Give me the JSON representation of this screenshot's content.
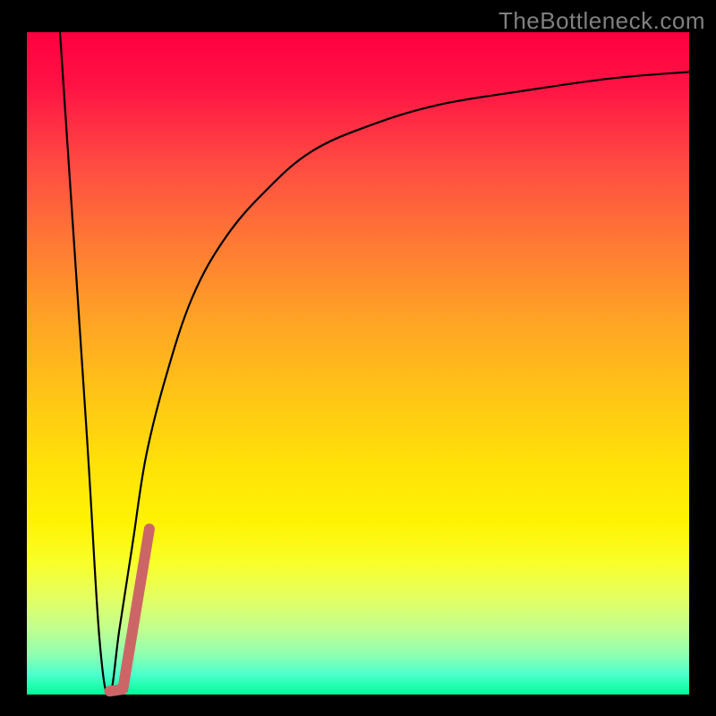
{
  "watermark": "TheBottleneck.com",
  "chart_data": {
    "type": "line",
    "title": "",
    "xlabel": "",
    "ylabel": "",
    "xlim": [
      0,
      100
    ],
    "ylim": [
      0,
      100
    ],
    "series": [
      {
        "name": "black-curve",
        "color": "#000000",
        "width": 2.2,
        "x": [
          5,
          9,
          11,
          12.5,
          14,
          16,
          18,
          21,
          25,
          30,
          36,
          43,
          52,
          62,
          74,
          88,
          100
        ],
        "values": [
          100,
          40,
          8,
          0,
          10,
          23,
          36,
          48,
          60,
          69,
          76,
          82,
          86,
          89,
          91,
          93,
          94
        ]
      },
      {
        "name": "salmon-overlay",
        "color": "#cc6666",
        "width": 12,
        "x": [
          12.5,
          14.5,
          18.5
        ],
        "values": [
          0.5,
          0.8,
          25
        ]
      }
    ],
    "gradient_stops": [
      {
        "pos": 0.0,
        "color": "#ff0040"
      },
      {
        "pos": 0.2,
        "color": "#ff4b42"
      },
      {
        "pos": 0.4,
        "color": "#ff9a2a"
      },
      {
        "pos": 0.6,
        "color": "#ffd810"
      },
      {
        "pos": 0.78,
        "color": "#fff808"
      },
      {
        "pos": 0.9,
        "color": "#c2ff8e"
      },
      {
        "pos": 1.0,
        "color": "#00ff99"
      }
    ]
  }
}
